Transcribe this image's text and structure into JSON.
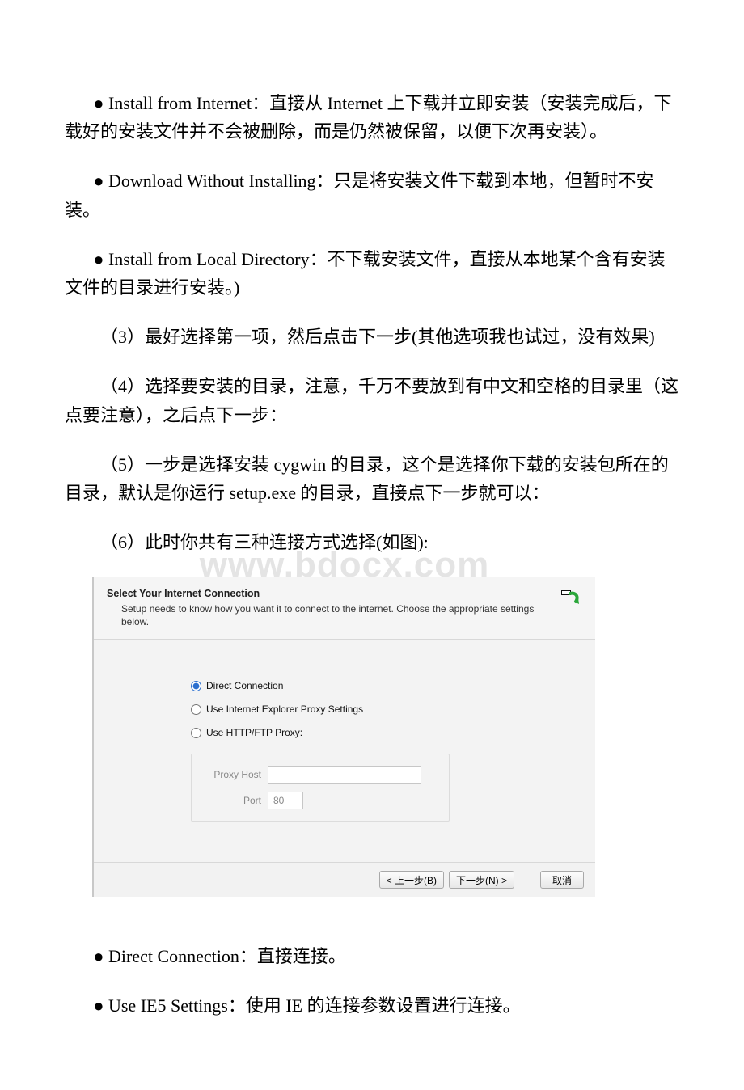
{
  "paragraphs": {
    "p1": "●  Install from Internet：直接从 Internet 上下载并立即安装（安装完成后，下载好的安装文件并不会被删除，而是仍然被保留，以便下次再安装）。",
    "p2": "●   Download Without Installing：只是将安装文件下载到本地，但暂时不安装。",
    "p3": "●   Install from Local Directory：不下载安装文件，直接从本地某个含有安装文件的目录进行安装。)",
    "p4": "（3）最好选择第一项，然后点击下一步(其他选项我也试过，没有效果)",
    "p5": "（4）选择要安装的目录，注意，千万不要放到有中文和空格的目录里（这点要注意），之后点下一步：",
    "p6": "（5）一步是选择安装 cygwin 的目录，这个是选择你下载的安装包所在的目录，默认是你运行 setup.exe 的目录，直接点下一步就可以：",
    "p7": "（6）此时你共有三种连接方式选择(如图):",
    "b1": "●  Direct Connection：直接连接。",
    "b2": "●  Use IE5 Settings：使用 IE 的连接参数设置进行连接。"
  },
  "dialog": {
    "title": "Select Your Internet Connection",
    "subtitle": "Setup needs to know how you want it to connect to the internet.  Choose the appropriate settings below.",
    "options": {
      "direct": "Direct Connection",
      "ieproxy": "Use Internet Explorer Proxy Settings",
      "httpproxy": "Use HTTP/FTP Proxy:"
    },
    "proxy": {
      "host_label": "Proxy Host",
      "host_value": "",
      "port_label": "Port",
      "port_value": "80"
    },
    "buttons": {
      "back": "< 上一步(B)",
      "next": "下一步(N) >",
      "cancel": "取消"
    }
  },
  "watermark": "www.bdocx.com"
}
